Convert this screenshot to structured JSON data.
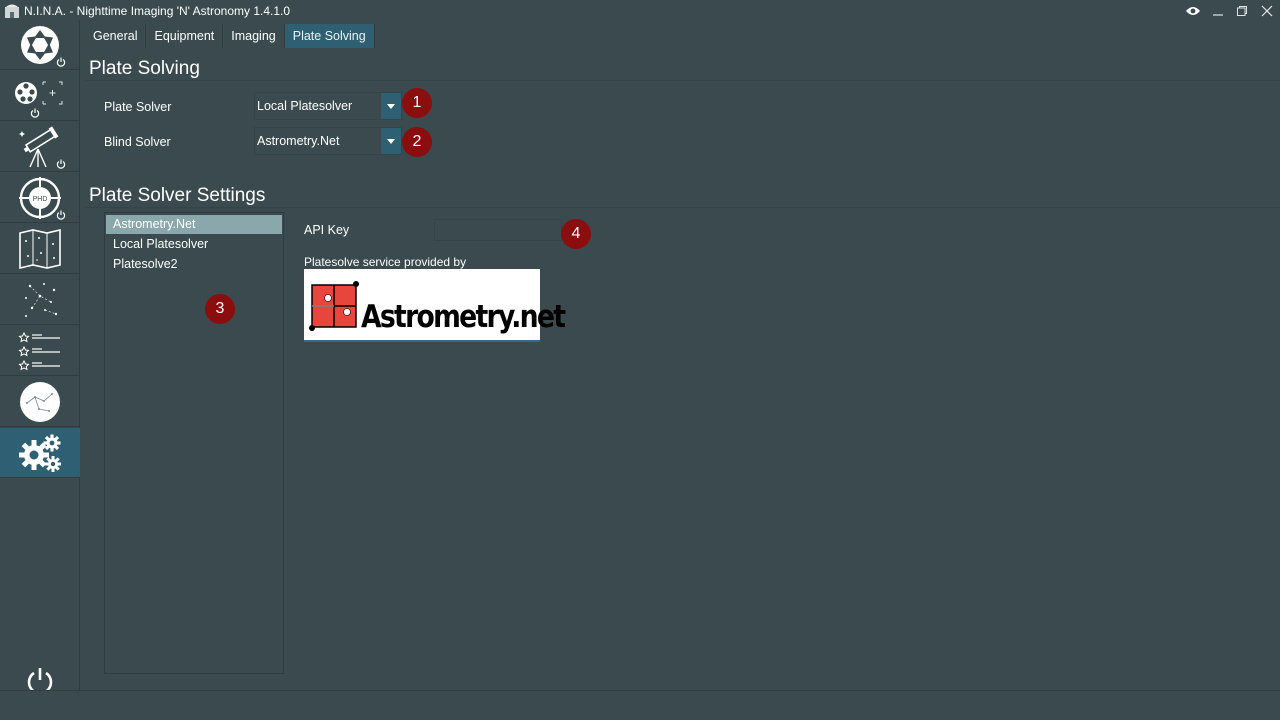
{
  "window": {
    "title": "N.I.N.A. - Nighttime Imaging 'N' Astronomy 1.4.1.0"
  },
  "sidebar": {
    "items": [
      {
        "icon": "camera-aperture-icon"
      },
      {
        "icon": "filter-wheel-icon"
      },
      {
        "icon": "telescope-icon"
      },
      {
        "icon": "phd-guider-icon"
      },
      {
        "icon": "sky-atlas-icon"
      },
      {
        "icon": "framing-icon"
      },
      {
        "icon": "sequence-icon"
      },
      {
        "icon": "sky-chart-icon"
      },
      {
        "icon": "settings-gears-icon",
        "active": true
      }
    ]
  },
  "tabs": [
    {
      "label": "General"
    },
    {
      "label": "Equipment"
    },
    {
      "label": "Imaging"
    },
    {
      "label": "Plate Solving",
      "active": true
    }
  ],
  "plate_solving": {
    "heading": "Plate Solving",
    "plate_solver_label": "Plate Solver",
    "plate_solver_value": "Local Platesolver",
    "blind_solver_label": "Blind Solver",
    "blind_solver_value": "Astrometry.Net"
  },
  "settings": {
    "heading": "Plate Solver Settings",
    "solvers": [
      "Astrometry.Net",
      "Local Platesolver",
      "Platesolve2"
    ],
    "selected_solver": "Astrometry.Net",
    "api_key_label": "API Key",
    "api_key_value": "",
    "provided_by": "Platesolve service provided by",
    "logo_text": "Astrometry.net"
  },
  "markers": [
    "1",
    "2",
    "3",
    "4"
  ],
  "colors": {
    "background": "#3a4a4e",
    "accent": "#2f5f72",
    "marker": "#8b0e0e",
    "selected_item": "#8aa8ab"
  }
}
